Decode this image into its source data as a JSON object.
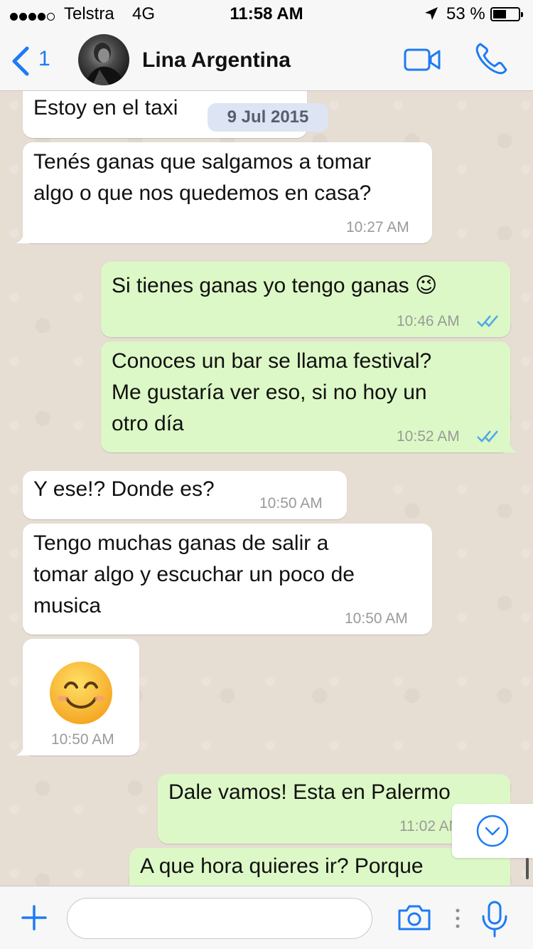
{
  "status_bar": {
    "carrier": "Telstra",
    "network": "4G",
    "time": "11:58 AM",
    "battery": "53 %",
    "battery_level": 0.53,
    "signal_bars": 4
  },
  "header": {
    "back_count": "1",
    "contact_name": "Lina Argentina"
  },
  "date_chip": "9 Jul 2015",
  "messages": [
    {
      "dir": "in",
      "text": "Estoy en el taxi",
      "time": ""
    },
    {
      "dir": "in",
      "text": "Tenés ganas que salgamos a tomar algo o que nos quedemos en casa?",
      "time": "10:27 AM"
    },
    {
      "dir": "out",
      "text": "Si tienes ganas yo tengo ganas 😉",
      "time": "10:46 AM",
      "read": true
    },
    {
      "dir": "out",
      "text": "Conoces un bar se llama festival? Me gustaría ver eso, si no hoy un otro día",
      "time": "10:52 AM",
      "read": true
    },
    {
      "dir": "in",
      "text": "Y ese!? Donde es?",
      "time": "10:50 AM"
    },
    {
      "dir": "in",
      "text": "Tengo muchas ganas de salir a tomar algo y escuchar un poco de musica",
      "time": "10:50 AM"
    },
    {
      "dir": "in",
      "text": "😊",
      "time": "10:50 AM"
    },
    {
      "dir": "out",
      "text": "Dale vamos! Esta en Palermo",
      "time": "11:02 AM",
      "read": true
    },
    {
      "dir": "out",
      "text": "A que hora quieres ir? Porque",
      "time": ""
    }
  ],
  "message_lines": {
    "m1": "Tenés ganas que salgamos a tomar\nalgo o que nos quedemos en casa?",
    "m3": "Conoces un bar se llama festival?\nMe gustaría ver eso, si no hoy un\notro día",
    "m5": "Tengo muchas ganas de salir a\ntomar algo y escuchar un poco de\nmusica"
  },
  "input": {
    "value": "",
    "placeholder": ""
  },
  "icons": {
    "back": "chevron-left-icon",
    "video": "video-camera-icon",
    "call": "phone-icon",
    "add": "plus-icon",
    "camera": "camera-icon",
    "mic": "microphone-icon",
    "scroll": "chevron-down-circle-icon",
    "read_receipt": "double-check-icon"
  },
  "colors": {
    "accent": "#1d7bf4",
    "outgoing_bubble": "#dcf8c6",
    "incoming_bubble": "#ffffff",
    "chat_background": "#e6ddd3",
    "read_ticks": "#4fa9e6"
  }
}
